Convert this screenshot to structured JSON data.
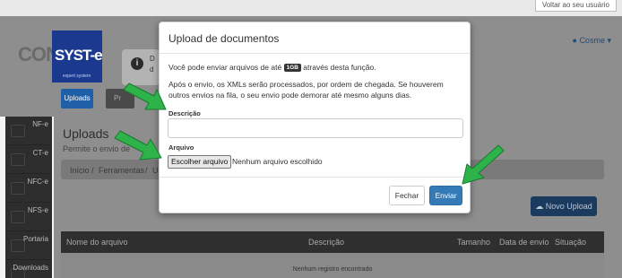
{
  "top_bar": {
    "back_user_label": "Voltar ao seu usuário"
  },
  "header": {
    "logo_left": "CON",
    "logo_right": "SYST-e",
    "logo_sub": "expert system",
    "alert_text_1": "D",
    "alert_text_2": "d",
    "user_name": "Cosme",
    "nav_uploads": "Uploads",
    "nav_second": "Pr"
  },
  "sidebar": {
    "items": [
      {
        "label": "NF-e"
      },
      {
        "label": "CT-e"
      },
      {
        "label": "NFC-e"
      },
      {
        "label": "NFS-e"
      },
      {
        "label": "Portaria"
      },
      {
        "label": "Downloads"
      }
    ]
  },
  "main": {
    "title": "Uploads",
    "subtitle": "Permite o envio de",
    "breadcrumb": [
      "Início",
      "Ferramentas",
      "Up"
    ],
    "new_upload_label": "Novo Upload",
    "table": {
      "columns": [
        "Nome do arquivo",
        "Descrição",
        "Tamanho",
        "Data de envio",
        "Situação"
      ],
      "empty_message": "Nenhum registro encontrado"
    }
  },
  "modal": {
    "title": "Upload de documentos",
    "line1_prefix": "Você pode enviar arquivos de até",
    "size_limit": "1GB",
    "line1_suffix": "através desta função.",
    "paragraph": "Após o envio, os XMLs serão processados, por ordem de chegada. Se houverem outros envios na fila, o seu envio pode demorar até mesmo alguns dias.",
    "description_label": "Descrição",
    "description_value": "",
    "file_label": "Arquivo",
    "file_button": "Escolher arquivo",
    "file_status": "Nenhum arquivo escolhido",
    "close_button": "Fechar",
    "submit_button": "Enviar"
  },
  "colors": {
    "primary": "#337ab7",
    "annotation_arrow": "#2db34a",
    "overlay_header": "#8e8e8e",
    "sidebar": "#2d2d2d"
  },
  "icons": [
    "info-icon",
    "user-icon",
    "caret-down-icon",
    "cloud-upload-icon",
    "arrow-annotation"
  ]
}
